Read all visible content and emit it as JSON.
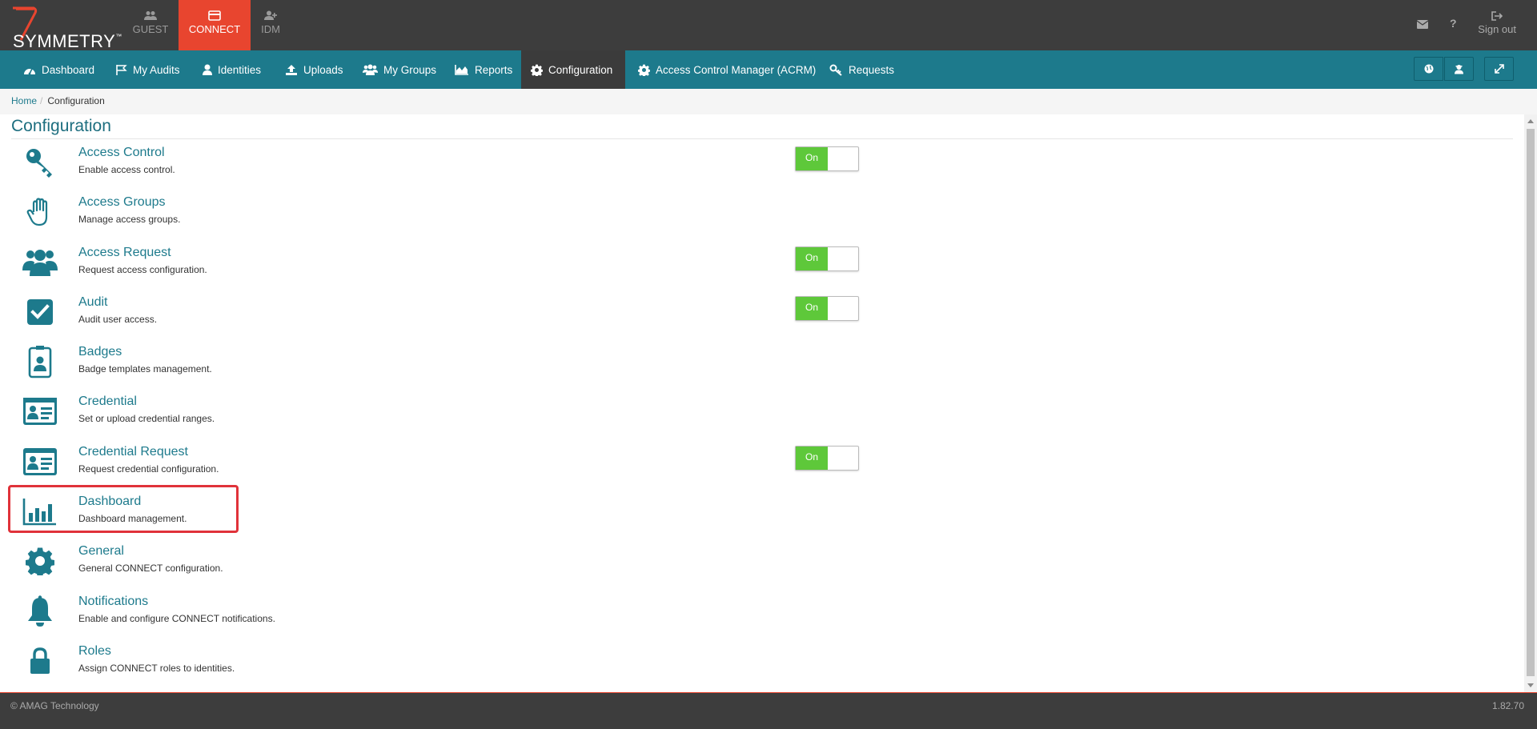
{
  "brand": {
    "name": "SYMMETRY",
    "tm": "™"
  },
  "apps": [
    {
      "label": "GUEST",
      "icon": "guest-icon"
    },
    {
      "label": "CONNECT",
      "icon": "connect-icon",
      "active": true
    },
    {
      "label": "IDM",
      "icon": "idm-icon"
    }
  ],
  "topbar": {
    "signout_label": "Sign out",
    "help_symbol": "?"
  },
  "nav": {
    "items": [
      {
        "label": "Dashboard",
        "icon": "dashboard-icon"
      },
      {
        "label": "My Audits",
        "icon": "flag-icon"
      },
      {
        "label": "Identities",
        "icon": "user-icon"
      },
      {
        "label": "Uploads",
        "icon": "upload-icon"
      },
      {
        "label": "My Groups",
        "icon": "group-icon"
      },
      {
        "label": "Reports",
        "icon": "area-chart-icon"
      },
      {
        "label": "Configuration",
        "icon": "gear-icon",
        "active": true
      },
      {
        "label": "Access Control Manager (ACRM)",
        "icon": "gear-icon"
      },
      {
        "label": "Requests",
        "icon": "keys-icon"
      }
    ]
  },
  "breadcrumb": {
    "home": "Home",
    "separator": "/",
    "current": "Configuration"
  },
  "page": {
    "title": "Configuration"
  },
  "config": {
    "items": [
      {
        "title": "Access Control",
        "desc": "Enable access control.",
        "toggle": "On",
        "icon": "key-icon"
      },
      {
        "title": "Access Groups",
        "desc": "Manage access groups.",
        "icon": "hand-icon"
      },
      {
        "title": "Access Request",
        "desc": "Request access configuration.",
        "toggle": "On",
        "icon": "users-icon"
      },
      {
        "title": "Audit",
        "desc": "Audit user access.",
        "toggle": "On",
        "icon": "checkbox-icon"
      },
      {
        "title": "Badges",
        "desc": "Badge templates management.",
        "icon": "badge-icon"
      },
      {
        "title": "Credential",
        "desc": "Set or upload credential ranges.",
        "icon": "id-card-icon"
      },
      {
        "title": "Credential Request",
        "desc": "Request credential configuration.",
        "toggle": "On",
        "icon": "id-card-icon"
      },
      {
        "title": "Dashboard",
        "desc": "Dashboard management.",
        "icon": "bar-chart-icon"
      },
      {
        "title": "General",
        "desc": "General CONNECT configuration.",
        "icon": "gear-icon"
      },
      {
        "title": "Notifications",
        "desc": "Enable and configure CONNECT notifications.",
        "icon": "bell-icon"
      },
      {
        "title": "Roles",
        "desc": "Assign CONNECT roles to identities.",
        "icon": "lock-icon"
      }
    ]
  },
  "footer": {
    "copyright": "© AMAG Technology",
    "version": "1.82.70"
  },
  "colors": {
    "accent": "#1d7a8c",
    "connect_red": "#e8452f",
    "toggle_green": "#5ec83a",
    "topbar": "#3d3d3d"
  }
}
